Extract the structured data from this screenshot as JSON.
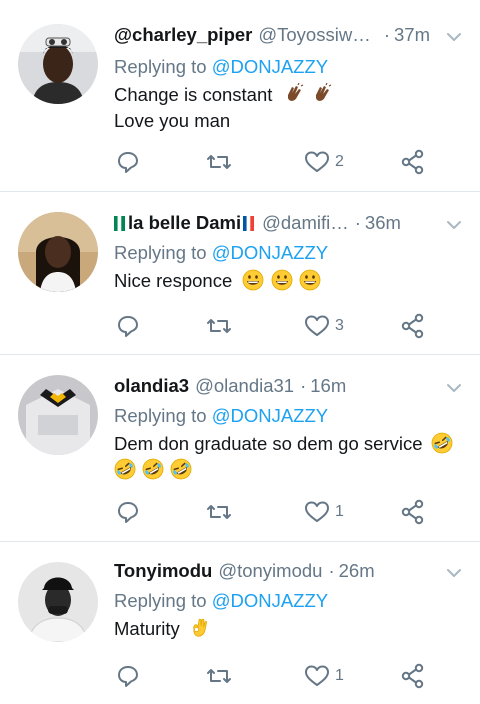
{
  "reply_prefix": "Replying to",
  "tweets": [
    {
      "name": "@charley_piper",
      "handle": "@Toyossiwh…",
      "time": "37m",
      "mention": "@DONJAZZY",
      "lines": [
        "Change is constant",
        "Love you man"
      ],
      "emoji_line1": [
        "clap-brown",
        "clap-brown"
      ],
      "likes": "2"
    },
    {
      "name": "la belle Dami",
      "name_flags": [
        "nigeria-flag",
        "france-flag"
      ],
      "handle": "@damifi…",
      "time": "36m",
      "mention": "@DONJAZZY",
      "lines": [
        "Nice responce"
      ],
      "emoji_line1": [
        "grin",
        "grin",
        "grin"
      ],
      "likes": "3"
    },
    {
      "name": "olandia3",
      "handle": "@olandia31",
      "time": "16m",
      "mention": "@DONJAZZY",
      "lines": [
        "Dem don graduate so dem go service"
      ],
      "emoji_line1": [
        "rofl"
      ],
      "emoji_line2": [
        "rofl",
        "rofl",
        "rofl"
      ],
      "likes": "1"
    },
    {
      "name": "Tonyimodu",
      "handle": "@tonyimodu",
      "time": "26m",
      "mention": "@DONJAZZY",
      "lines": [
        "Maturity"
      ],
      "emoji_line1": [
        "ok-hand"
      ],
      "likes": "1"
    }
  ],
  "colors": {
    "link": "#1da1f2",
    "secondary": "#657786",
    "icon": "#657786",
    "divider": "#e1e8ed"
  },
  "icons": {
    "reply": "reply-icon",
    "retweet": "retweet-icon",
    "like": "heart-icon",
    "share": "share-icon",
    "more": "chevron-down-icon"
  }
}
